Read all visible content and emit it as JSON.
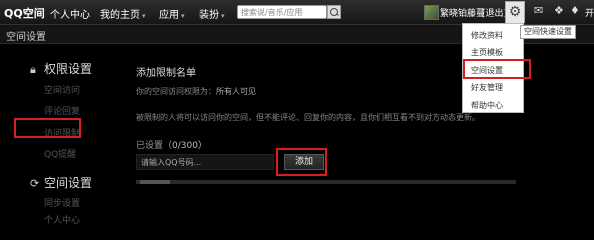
{
  "topbar": {
    "logo": "QQ空间",
    "nav": [
      "个人中心",
      "我的主页",
      "应用",
      "装扮"
    ],
    "search_placeholder": "搜索说/音乐/应用",
    "username": "繁晓铂藤蔓",
    "logout": "[退出]",
    "more": "开"
  },
  "title_bar": {
    "title": "空间设置"
  },
  "sidebar": {
    "section1": "权限设置",
    "section1_items": [
      "空间访问",
      "评论回复",
      "访问限制",
      "QQ提醒"
    ],
    "section2": "空间设置",
    "section2_items": [
      "同步设置",
      "个人中心"
    ]
  },
  "main": {
    "heading": "添加限制名单",
    "perm_prefix": "你的空间访问权限为：",
    "perm_value": "所有人可见",
    "description": "被限制的人将可以访问你的空间，但不能评论、回复你的内容，且你们相互看不到对方动态更新。",
    "count_label": "已设置（",
    "count_value": "0",
    "count_sep": "/300）",
    "input_placeholder": "请输入QQ号码...",
    "add_label": "添加"
  },
  "dropdown": {
    "items": [
      "修改资料",
      "主页模板",
      "空间设置",
      "好友管理",
      "帮助中心"
    ]
  },
  "tooltip": "空间快速设置",
  "colors": {
    "highlight": "#d81e1e",
    "background": "#000000"
  }
}
